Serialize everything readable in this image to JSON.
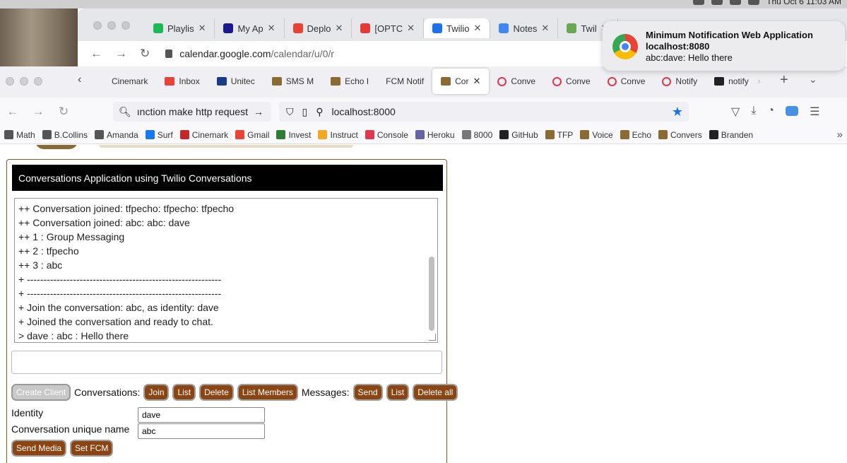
{
  "menubar": {
    "clock": "Thu Oct 6  11:03 AM"
  },
  "back_window": {
    "tabs": [
      {
        "label": "Playlis",
        "color": "#1db954"
      },
      {
        "label": "My Ap",
        "color": "#1a1a8c"
      },
      {
        "label": "Deplo",
        "color": "#ea4335"
      },
      {
        "label": "[OPTC",
        "color": "#e53935"
      },
      {
        "label": "Twilio",
        "color": "#1a73e8",
        "active": true
      },
      {
        "label": "Notes",
        "color": "#4285f4"
      },
      {
        "label": "Twil",
        "color": "#6aa84f"
      }
    ],
    "url_host": "calendar.google.com",
    "url_path": "/calendar/u/0/r"
  },
  "notification": {
    "title": "Minimum Notification Web Application",
    "origin": "localhost:8080",
    "body": "abc:dave: Hello there"
  },
  "front_window": {
    "tabs": [
      {
        "label": "Cinemark",
        "color": ""
      },
      {
        "label": "Inbox",
        "color": "#ea4335"
      },
      {
        "label": "Unitec",
        "color": "#1a3b8c"
      },
      {
        "label": "SMS M",
        "color": "#8b6a34"
      },
      {
        "label": "Echo I",
        "color": "#8b6a34"
      },
      {
        "label": "FCM Notif",
        "color": ""
      },
      {
        "label": "Cor",
        "color": "#8b6a34",
        "active": true
      },
      {
        "label": "Conve",
        "color": "#e0394b",
        "round": true
      },
      {
        "label": "Conve",
        "color": "#e0394b",
        "round": true
      },
      {
        "label": "Conve",
        "color": "#e0394b",
        "round": true
      },
      {
        "label": "Notify",
        "color": "#e0394b",
        "round": true
      },
      {
        "label": "notify",
        "color": "#222"
      }
    ],
    "search_text": "ınction make http request",
    "url": "localhost:8000",
    "bookmarks": [
      {
        "label": "Math",
        "color": "#555"
      },
      {
        "label": "B.Collins",
        "color": "#555"
      },
      {
        "label": "Amanda",
        "color": "#555"
      },
      {
        "label": "Surf",
        "color": "#1877f2"
      },
      {
        "label": "Cinemark",
        "color": "#c62828"
      },
      {
        "label": "Gmail",
        "color": "#ea4335"
      },
      {
        "label": "Invest",
        "color": "#2e7d32"
      },
      {
        "label": "Instruct",
        "color": "#f5a623"
      },
      {
        "label": "Console",
        "color": "#e0394b"
      },
      {
        "label": "Heroku",
        "color": "#6762a6"
      },
      {
        "label": "8000",
        "color": "#777"
      },
      {
        "label": "GitHub",
        "color": "#222"
      },
      {
        "label": "TFP",
        "color": "#8b6a34"
      },
      {
        "label": "Voice",
        "color": "#8b6a34"
      },
      {
        "label": "Echo",
        "color": "#8b6a34"
      },
      {
        "label": "Convers",
        "color": "#8b6a34"
      },
      {
        "label": "Branden",
        "color": "#222"
      }
    ]
  },
  "app": {
    "header": "Conversations Application using Twilio Conversations",
    "log_lines": [
      "++ Conversation joined: tfpecho: tfpecho: tfpecho",
      "++ Conversation joined: abc: abc: dave",
      "++ 1 : Group Messaging",
      "++ 2 : tfpecho",
      "++ 3 : abc",
      "+ -----------------------------------------------------------",
      "+ -----------------------------------------------------------",
      "+ Join the conversation: abc, as identity: dave",
      "+ Joined the conversation and ready to chat.",
      "> dave : abc : Hello there"
    ],
    "message_input": "",
    "create_client_label": "Create Client",
    "conversations_label": "Conversations:",
    "join_label": "Join",
    "list_label": "List",
    "delete_label": "Delete",
    "list_members_label": "List Members",
    "messages_label": "Messages:",
    "send_label": "Send",
    "list2_label": "List",
    "delete_all_label": "Delete all",
    "identity_label": "Identity",
    "identity_value": "dave",
    "conv_name_label": "Conversation unique name",
    "conv_name_value": "abc",
    "send_media_label": "Send Media",
    "set_fcm_label": "Set FCM"
  }
}
